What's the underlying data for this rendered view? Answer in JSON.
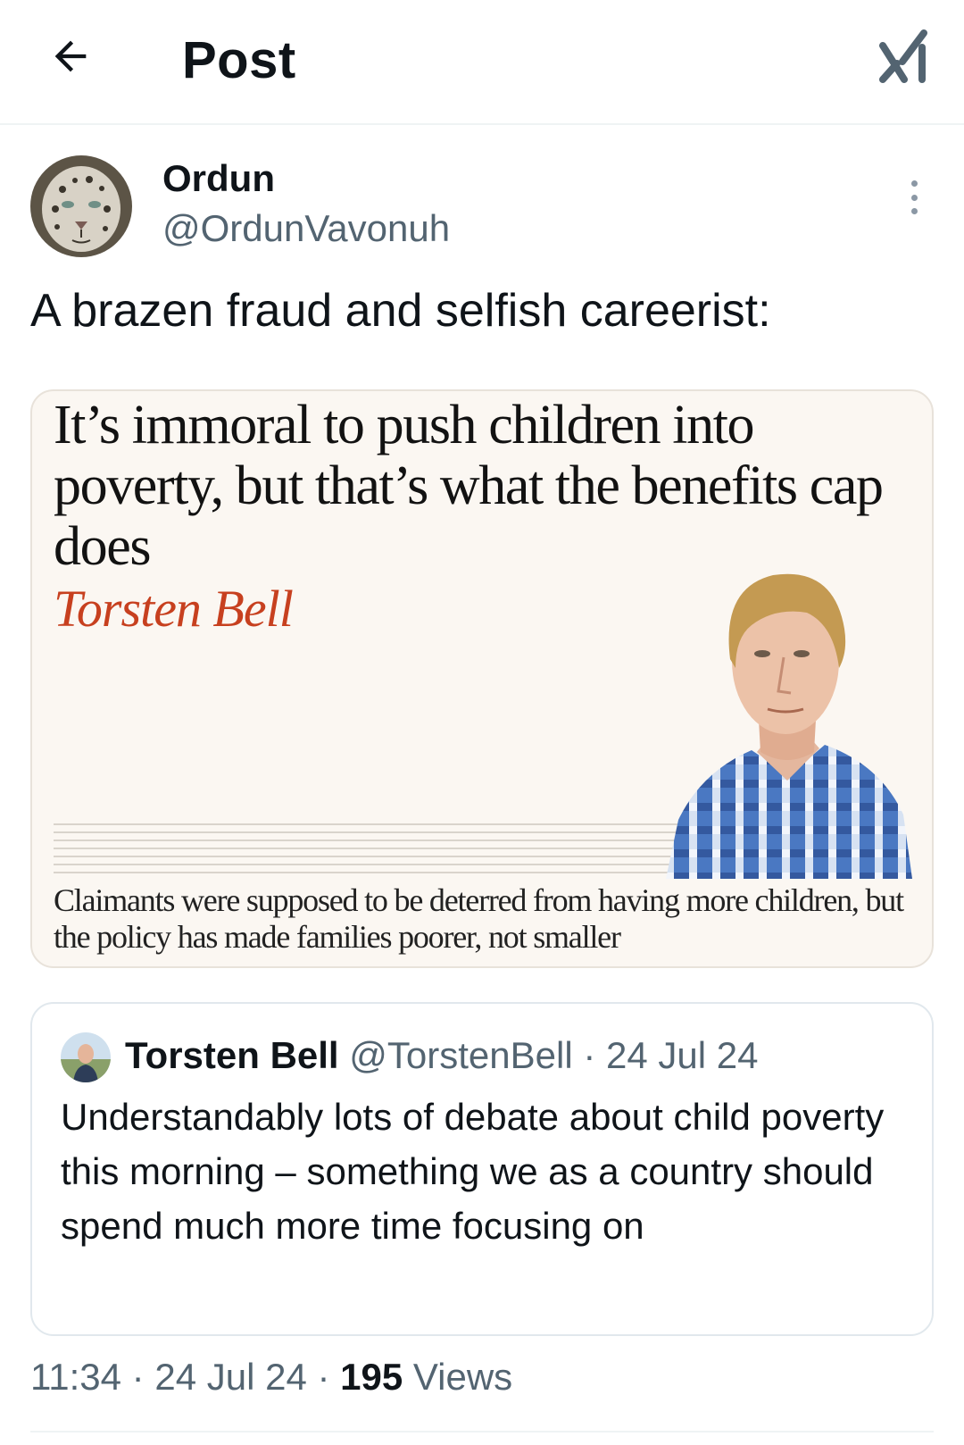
{
  "header": {
    "title": "Post",
    "back_icon": "arrow-left-icon",
    "grok_icon": "grok-icon"
  },
  "post": {
    "author_name": "Ordun",
    "author_handle": "@OrdunVavonuh",
    "text": "A brazen fraud and selfish careerist:",
    "more_icon": "more-vertical-icon"
  },
  "media": {
    "headline": "It’s immoral to push children into poverty, but that’s what the benefits cap does",
    "byline": "Torsten Bell",
    "caption": "Claimants were supposed to be deterred from having more children, but the policy has made families poorer, not smaller"
  },
  "quoted": {
    "name": "Torsten Bell",
    "handle": "@TorstenBell",
    "separator": "·",
    "date": "24 Jul 24",
    "text": "Understandably lots of debate about child poverty this morning – something we as a country should spend much more time focusing on"
  },
  "meta": {
    "time": "11:34",
    "separator": "·",
    "date": "24 Jul 24",
    "views_count": "195",
    "views_label": "Views"
  },
  "colors": {
    "byline": "#c7401f",
    "secondary_text": "#536471",
    "card_background": "#fbf7f2"
  }
}
